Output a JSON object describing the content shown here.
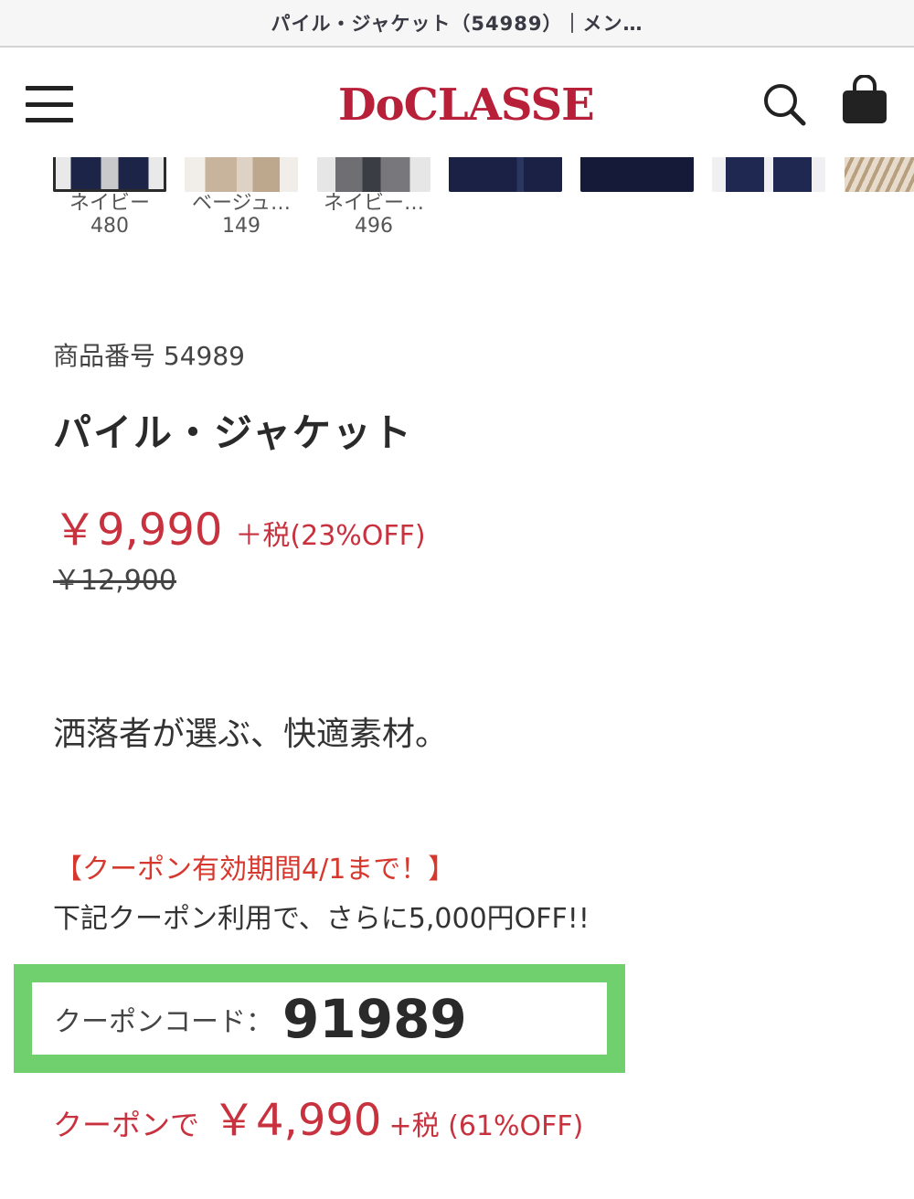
{
  "browser": {
    "tab_title": "パイル・ジャケット（54989）｜メン…"
  },
  "header": {
    "logo_text": "DoCLASSE",
    "brand_color": "#b8203a",
    "menu_icon": "hamburger-icon",
    "search_icon": "search-icon",
    "cart_icon": "shopping-bag-icon"
  },
  "color_variants": [
    {
      "label": "ネイビー",
      "count": "480",
      "selected": true
    },
    {
      "label": "ベージュ…",
      "count": "149",
      "selected": false
    },
    {
      "label": "ネイビー…",
      "count": "496",
      "selected": false
    },
    {
      "label": "",
      "count": "",
      "selected": false
    },
    {
      "label": "",
      "count": "",
      "selected": false
    },
    {
      "label": "",
      "count": "",
      "selected": false
    },
    {
      "label": "",
      "count": "",
      "selected": false
    }
  ],
  "product": {
    "number": "商品番号 54989",
    "title": "パイル・ジャケット",
    "price": "￥9,990",
    "tax_discount": "＋税(23%OFF)",
    "original_price": "￥12,900",
    "catch_copy": "洒落者が選ぶ、快適素材。",
    "price_color": "#c8313e"
  },
  "coupon": {
    "period": "【クーポン有効期間4/1まで！】",
    "note": "下記クーポン利用で、さらに5,000円OFF!!",
    "code_label": "クーポンコード：",
    "code": "91989",
    "highlight_color": "#6fd06d",
    "price_prefix": "クーポンで",
    "price": "￥4,990",
    "tax_discount": "+税 (61%OFF)"
  }
}
